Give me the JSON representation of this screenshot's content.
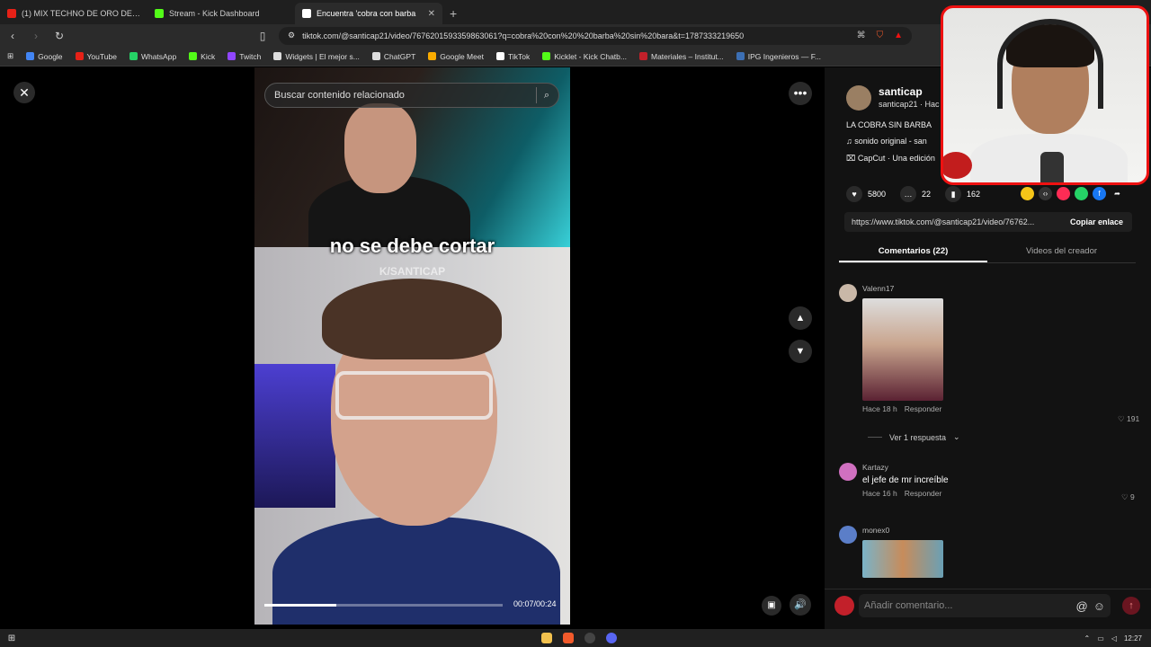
{
  "browser": {
    "tabs": [
      {
        "label": "(1) MIX TECHNO DE ORO DE 80's &",
        "active": false,
        "color": "#e62117"
      },
      {
        "label": "Stream - Kick Dashboard",
        "active": false,
        "color": "#53fc18"
      },
      {
        "label": "Encuentra 'cobra con barba",
        "active": true,
        "color": "#ffffff"
      }
    ],
    "url": "tiktok.com/@santicap21/video/7676201593359863061?q=cobra%20con%20%20barba%20sin%20bara&t=1787333219650",
    "bookmarks": [
      {
        "label": "Google",
        "color": "#4285f4"
      },
      {
        "label": "YouTube",
        "color": "#e62117"
      },
      {
        "label": "WhatsApp",
        "color": "#25d366"
      },
      {
        "label": "Kick",
        "color": "#53fc18"
      },
      {
        "label": "Twitch",
        "color": "#9146ff"
      },
      {
        "label": "Widgets | El mejor s...",
        "color": "#dddddd"
      },
      {
        "label": "ChatGPT",
        "color": "#dddddd"
      },
      {
        "label": "Google Meet",
        "color": "#f9ab00"
      },
      {
        "label": "TikTok",
        "color": "#ffffff"
      },
      {
        "label": "Kicklet - Kick Chatb...",
        "color": "#53fc18"
      },
      {
        "label": "Materiales – Institut...",
        "color": "#c2202a"
      },
      {
        "label": "IPG Ingenieros — F...",
        "color": "#3c6fb4"
      }
    ]
  },
  "player": {
    "search_placeholder": "Buscar contenido relacionado",
    "caption": "no se debe cortar",
    "watermark": "K/SANTICAP",
    "time": "00:07/00:24",
    "progress": 0.3
  },
  "author": {
    "name": "santicap",
    "sub": "santicap21 · Hac",
    "description": "LA COBRA SIN BARBA",
    "music": "sonido original - san",
    "capcut": "CapCut · Una edición"
  },
  "stats": {
    "likes": "5800",
    "comments": "22",
    "saves": "162"
  },
  "link": {
    "url": "https://www.tiktok.com/@santicap21/video/76762...",
    "copy_label": "Copiar enlace"
  },
  "panel_tabs": {
    "comments": "Comentarios (22)",
    "creator_videos": "Videos del creador"
  },
  "comments": [
    {
      "user": "Valenn17",
      "text": "",
      "time": "Hace 18 h",
      "reply": "Responder",
      "likes": "191"
    },
    {
      "user": "Kartazy",
      "text": "el jefe de mr increíble",
      "time": "Hace 16 h",
      "reply": "Responder",
      "likes": "9"
    },
    {
      "user": "monex0",
      "text": "",
      "time": "",
      "reply": "",
      "likes": ""
    }
  ],
  "view_replies": "Ver 1 respuesta",
  "add_comment_placeholder": "Añadir comentario...",
  "taskbar": {
    "time": "12:27"
  }
}
